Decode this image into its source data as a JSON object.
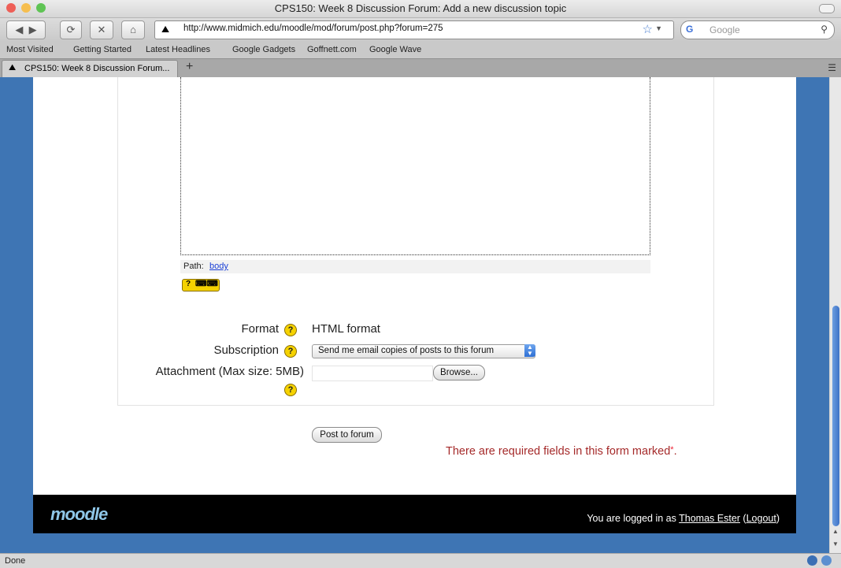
{
  "window": {
    "title": "CPS150: Week 8 Discussion Forum: Add a new discussion topic"
  },
  "toolbar": {
    "url": "http://www.midmich.edu/moodle/mod/forum/post.php?forum=275",
    "search_placeholder": "Google"
  },
  "bookmarks": {
    "items": [
      "Most Visited",
      "Getting Started",
      "Latest Headlines",
      "Google Gadgets",
      "Goffnett.com",
      "Google Wave"
    ]
  },
  "tabs": [
    {
      "label": "CPS150: Week 8 Discussion Forum..."
    }
  ],
  "editor": {
    "path_label": "Path:",
    "path_value": "body"
  },
  "form": {
    "format_label": "Format",
    "format_value": "HTML format",
    "subscription_label": "Subscription",
    "subscription_value": "Send me email copies of posts to this forum",
    "attachment_label": "Attachment (Max size: 5MB)",
    "browse_label": "Browse...",
    "submit_label": "Post to forum",
    "required_text": "There are required fields in this form marked",
    "required_mark": "*",
    "required_end": "."
  },
  "footer": {
    "logo": "moodle",
    "logged_in_prefix": "You are logged in as",
    "user_name": "Thomas Ester",
    "logout_label": "Logout"
  },
  "status": {
    "text": "Done"
  }
}
